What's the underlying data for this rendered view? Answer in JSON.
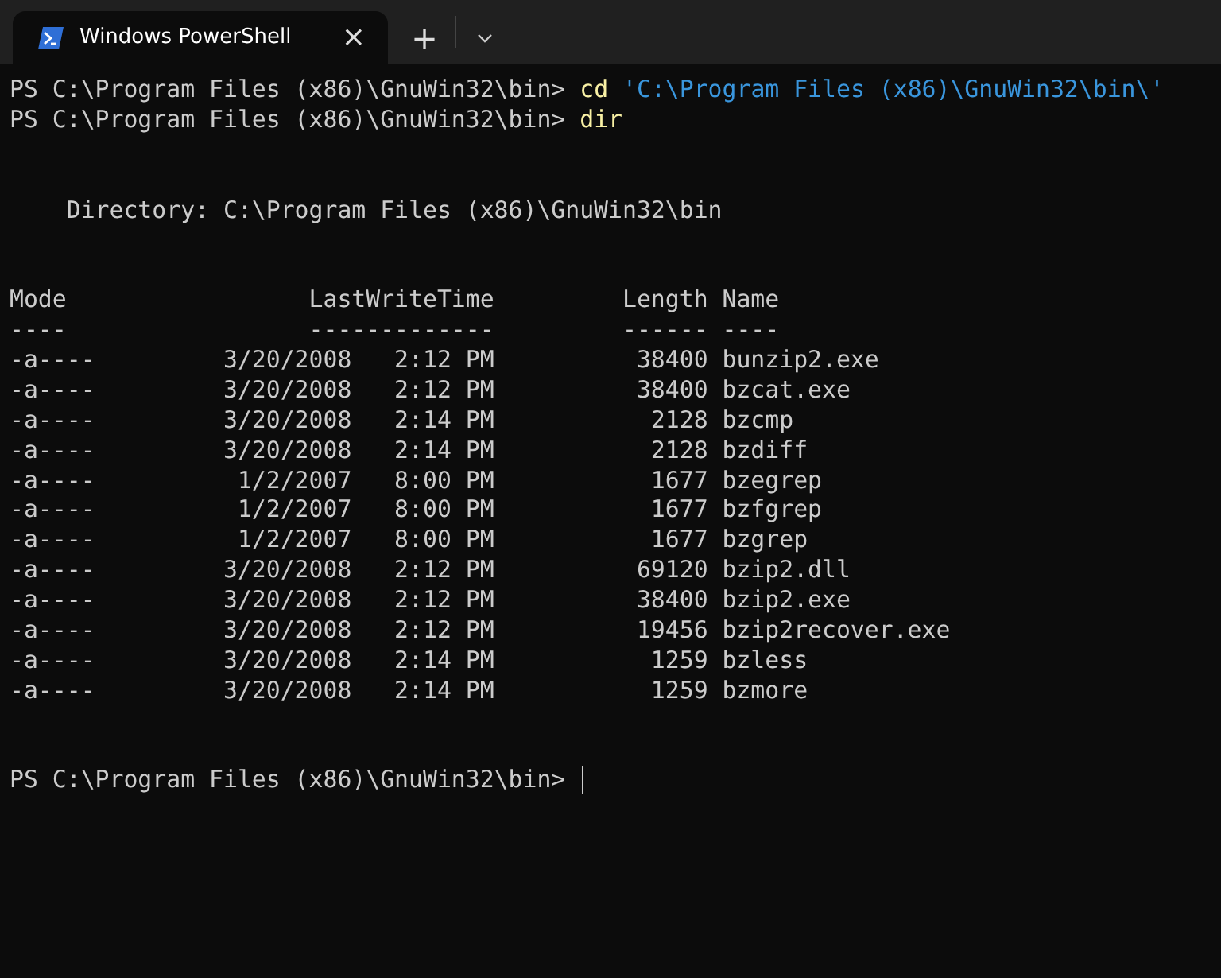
{
  "tab": {
    "title": "Windows PowerShell",
    "selected": true,
    "close": "×"
  },
  "new_tab": "+",
  "lines": [
    {
      "kind": "prompt",
      "prompt": "PS C:\\Program Files (x86)\\GnuWin32\\bin> ",
      "command": "cd",
      "argument": "'C:\\Program Files (x86)\\GnuWin32\\bin\\'",
      "cursor": false
    },
    {
      "kind": "prompt",
      "prompt": "PS C:\\Program Files (x86)\\GnuWin32\\bin> ",
      "command": "dir",
      "cursor": false
    },
    {
      "kind": "blank"
    },
    {
      "kind": "blank"
    },
    {
      "kind": "text",
      "text": "    Directory: C:\\Program Files (x86)\\GnuWin32\\bin"
    },
    {
      "kind": "blank"
    },
    {
      "kind": "blank"
    },
    {
      "kind": "text",
      "text": "Mode                 LastWriteTime         Length Name"
    },
    {
      "kind": "text",
      "text": "----                 -------------         ------ ----"
    },
    {
      "kind": "text",
      "text": "-a----         3/20/2008   2:12 PM          38400 bunzip2.exe"
    },
    {
      "kind": "text",
      "text": "-a----         3/20/2008   2:12 PM          38400 bzcat.exe"
    },
    {
      "kind": "text",
      "text": "-a----         3/20/2008   2:14 PM           2128 bzcmp"
    },
    {
      "kind": "text",
      "text": "-a----         3/20/2008   2:14 PM           2128 bzdiff"
    },
    {
      "kind": "text",
      "text": "-a----          1/2/2007   8:00 PM           1677 bzegrep"
    },
    {
      "kind": "text",
      "text": "-a----          1/2/2007   8:00 PM           1677 bzfgrep"
    },
    {
      "kind": "text",
      "text": "-a----          1/2/2007   8:00 PM           1677 bzgrep"
    },
    {
      "kind": "text",
      "text": "-a----         3/20/2008   2:12 PM          69120 bzip2.dll"
    },
    {
      "kind": "text",
      "text": "-a----         3/20/2008   2:12 PM          38400 bzip2.exe"
    },
    {
      "kind": "text",
      "text": "-a----         3/20/2008   2:12 PM          19456 bzip2recover.exe"
    },
    {
      "kind": "text",
      "text": "-a----         3/20/2008   2:14 PM           1259 bzless"
    },
    {
      "kind": "text",
      "text": "-a----         3/20/2008   2:14 PM           1259 bzmore"
    },
    {
      "kind": "blank"
    },
    {
      "kind": "blank"
    },
    {
      "kind": "prompt",
      "prompt": "PS C:\\Program Files (x86)\\GnuWin32\\bin> ",
      "cursor": true
    }
  ]
}
